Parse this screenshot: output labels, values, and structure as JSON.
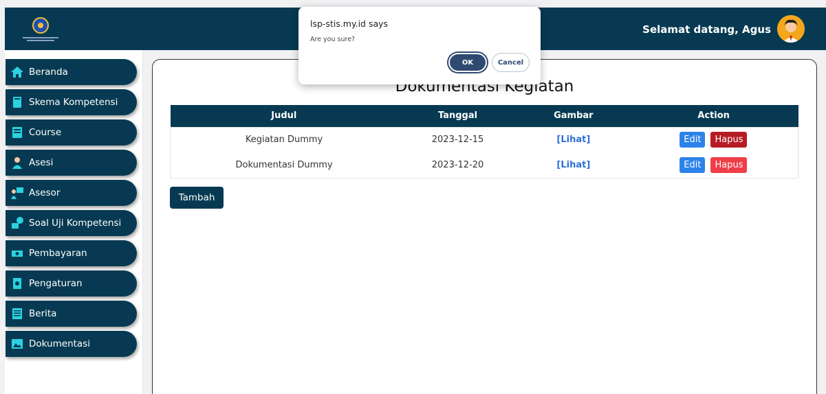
{
  "header": {
    "welcome_text": "Selamat datang, Agus",
    "logo_icon": "institution-logo",
    "avatar_icon": "user-avatar-icon"
  },
  "sidebar": {
    "items": [
      {
        "label": "Beranda",
        "icon": "home-icon"
      },
      {
        "label": "Skema Kompetensi",
        "icon": "book-icon"
      },
      {
        "label": "Course",
        "icon": "notebook-icon"
      },
      {
        "label": "Asesi",
        "icon": "person-icon"
      },
      {
        "label": "Asesor",
        "icon": "teacher-icon"
      },
      {
        "label": "Soal Uji Kompetensi",
        "icon": "quiz-icon"
      },
      {
        "label": "Pembayaran",
        "icon": "money-icon"
      },
      {
        "label": "Pengaturan",
        "icon": "settings-doc-icon"
      },
      {
        "label": "Berita",
        "icon": "newspaper-icon"
      },
      {
        "label": "Dokumentasi",
        "icon": "image-icon"
      }
    ]
  },
  "main": {
    "title": "Dokumentasi Kegiatan",
    "table": {
      "headers": [
        "Judul",
        "Tanggal",
        "Gambar",
        "Action"
      ],
      "rows": [
        {
          "judul": "Kegiatan Dummy",
          "tanggal": "2023-12-15",
          "gambar": "[Lihat]",
          "edit": "Edit",
          "hapus": "Hapus"
        },
        {
          "judul": "Dokumentasi Dummy",
          "tanggal": "2023-12-20",
          "gambar": "[Lihat]",
          "edit": "Edit",
          "hapus": "Hapus"
        }
      ]
    },
    "add_button": "Tambah"
  },
  "dialog": {
    "title": "lsp-stis.my.id says",
    "message": "Are you sure?",
    "ok_label": "OK",
    "cancel_label": "Cancel"
  },
  "colors": {
    "primary": "#073a52",
    "edit": "#2d82ea",
    "delete": "#ef3e48",
    "delete_active": "#b71c24",
    "link": "#2d6fd6"
  }
}
